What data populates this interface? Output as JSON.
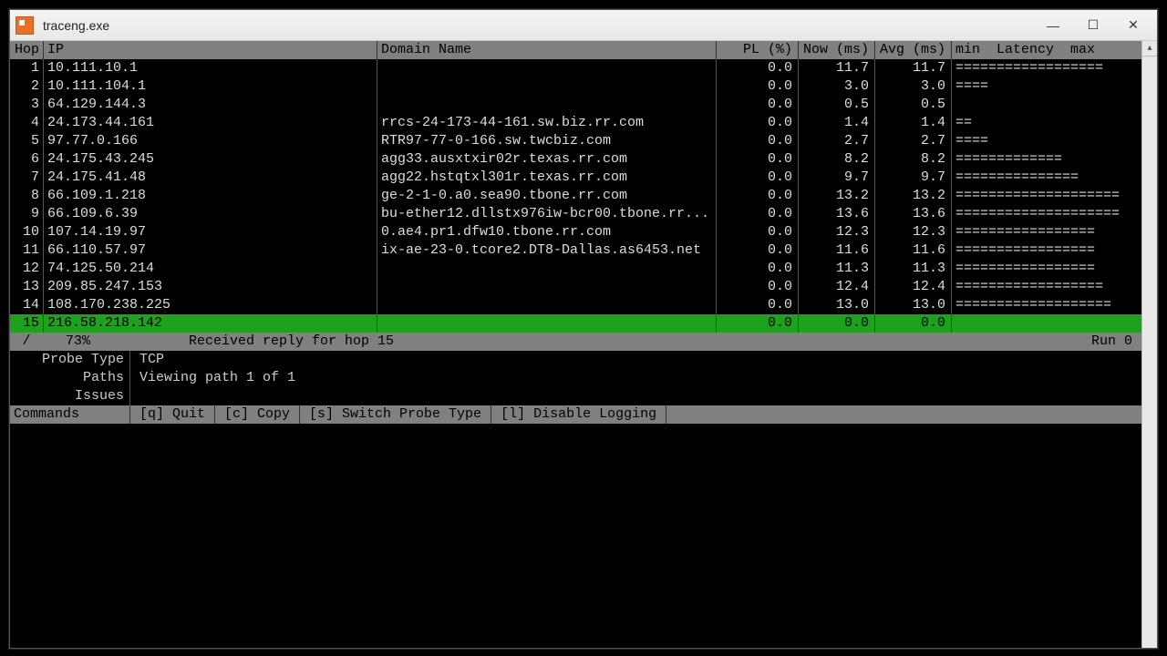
{
  "window": {
    "title": "traceng.exe"
  },
  "columns": {
    "hop": "Hop",
    "ip": "IP",
    "domain": "Domain Name",
    "pl": "PL (%)",
    "now": "Now (ms)",
    "avg": "Avg (ms)",
    "lat": "min  Latency  max"
  },
  "rows": [
    {
      "hop": "1",
      "ip": "10.111.10.1",
      "domain": "",
      "pl": "0.0",
      "now": "11.7",
      "avg": "11.7",
      "lat": "=================="
    },
    {
      "hop": "2",
      "ip": "10.111.104.1",
      "domain": "",
      "pl": "0.0",
      "now": "3.0",
      "avg": "3.0",
      "lat": "===="
    },
    {
      "hop": "3",
      "ip": "64.129.144.3",
      "domain": "",
      "pl": "0.0",
      "now": "0.5",
      "avg": "0.5",
      "lat": ""
    },
    {
      "hop": "4",
      "ip": "24.173.44.161",
      "domain": "rrcs-24-173-44-161.sw.biz.rr.com",
      "pl": "0.0",
      "now": "1.4",
      "avg": "1.4",
      "lat": "=="
    },
    {
      "hop": "5",
      "ip": "97.77.0.166",
      "domain": "RTR97-77-0-166.sw.twcbiz.com",
      "pl": "0.0",
      "now": "2.7",
      "avg": "2.7",
      "lat": "===="
    },
    {
      "hop": "6",
      "ip": "24.175.43.245",
      "domain": "agg33.ausxtxir02r.texas.rr.com",
      "pl": "0.0",
      "now": "8.2",
      "avg": "8.2",
      "lat": "============="
    },
    {
      "hop": "7",
      "ip": "24.175.41.48",
      "domain": "agg22.hstqtxl301r.texas.rr.com",
      "pl": "0.0",
      "now": "9.7",
      "avg": "9.7",
      "lat": "==============="
    },
    {
      "hop": "8",
      "ip": "66.109.1.218",
      "domain": "ge-2-1-0.a0.sea90.tbone.rr.com",
      "pl": "0.0",
      "now": "13.2",
      "avg": "13.2",
      "lat": "===================="
    },
    {
      "hop": "9",
      "ip": "66.109.6.39",
      "domain": "bu-ether12.dllstx976iw-bcr00.tbone.rr...",
      "pl": "0.0",
      "now": "13.6",
      "avg": "13.6",
      "lat": "===================="
    },
    {
      "hop": "10",
      "ip": "107.14.19.97",
      "domain": "0.ae4.pr1.dfw10.tbone.rr.com",
      "pl": "0.0",
      "now": "12.3",
      "avg": "12.3",
      "lat": "================="
    },
    {
      "hop": "11",
      "ip": "66.110.57.97",
      "domain": "ix-ae-23-0.tcore2.DT8-Dallas.as6453.net",
      "pl": "0.0",
      "now": "11.6",
      "avg": "11.6",
      "lat": "================="
    },
    {
      "hop": "12",
      "ip": "74.125.50.214",
      "domain": "",
      "pl": "0.0",
      "now": "11.3",
      "avg": "11.3",
      "lat": "================="
    },
    {
      "hop": "13",
      "ip": "209.85.247.153",
      "domain": "",
      "pl": "0.0",
      "now": "12.4",
      "avg": "12.4",
      "lat": "=================="
    },
    {
      "hop": "14",
      "ip": "108.170.238.225",
      "domain": "",
      "pl": "0.0",
      "now": "13.0",
      "avg": "13.0",
      "lat": "==================="
    },
    {
      "hop": "15",
      "ip": "216.58.218.142",
      "domain": "",
      "pl": "0.0",
      "now": "0.0",
      "avg": "0.0",
      "lat": "",
      "highlight": true
    }
  ],
  "status": {
    "spinner": "/",
    "percent": "73%",
    "message": "Received reply for hop 15",
    "run": "Run 0"
  },
  "info": {
    "probe_label": "Probe Type",
    "probe_value": "TCP",
    "paths_label": "Paths",
    "paths_value": "Viewing path 1 of 1",
    "issues_label": "Issues",
    "issues_value": ""
  },
  "commands": {
    "label": "Commands",
    "items": [
      "[q] Quit",
      "[c] Copy",
      "[s] Switch Probe Type",
      "[l] Disable Logging"
    ]
  }
}
